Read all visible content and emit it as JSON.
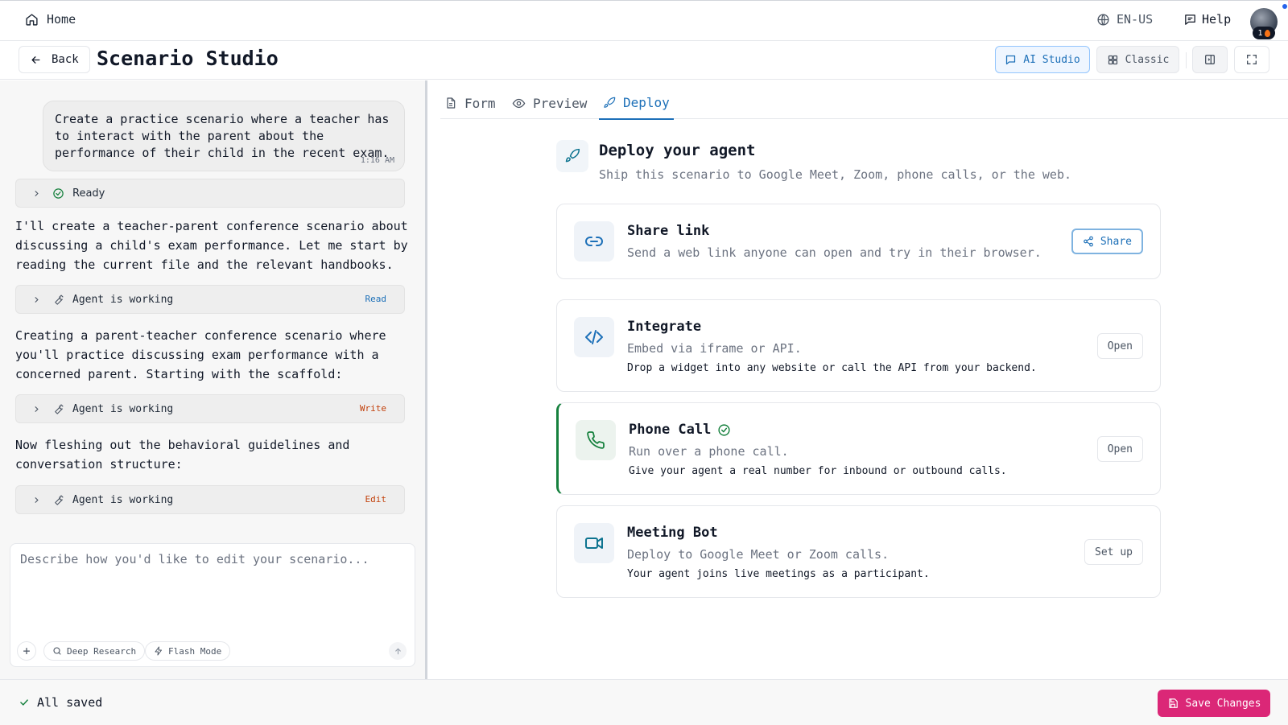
{
  "nav": {
    "home_label": "Home",
    "language": "EN-US",
    "help_label": "Help",
    "avatar_badge": "1"
  },
  "header": {
    "back_label": "Back",
    "title": "Scenario Studio",
    "mode_ai_label": "AI Studio",
    "mode_classic_label": "Classic"
  },
  "chat": {
    "user_message": "Create a practice scenario where a teacher has to interact with the parent about the performance of their child in the recent exam.",
    "user_time": "1:16 AM",
    "status_row": {
      "label": "Ready"
    },
    "messages": [
      "I'll create a teacher-parent conference scenario about discussing a child's exam performance. Let me start by reading the current file and the relevant handbooks.",
      "Creating a parent-teacher conference scenario where you'll practice discussing exam performance with a concerned parent. Starting with the scaffold:",
      "Now fleshing out the behavioral guidelines and conversation structure:"
    ],
    "tool_rows": [
      {
        "label": "Agent is working",
        "tag": "Read",
        "tag_color": "#1d70b8"
      },
      {
        "label": "Agent is working",
        "tag": "Write",
        "tag_color": "#c2410c"
      },
      {
        "label": "Agent is working",
        "tag": "Edit",
        "tag_color": "#c2410c"
      }
    ],
    "input_placeholder": "Describe how you'd like to edit your scenario...",
    "chips": [
      "Deep Research",
      "Flash Mode"
    ]
  },
  "tabs": [
    {
      "label": "Form",
      "icon": "file-text-icon"
    },
    {
      "label": "Preview",
      "icon": "eye-icon"
    },
    {
      "label": "Deploy",
      "icon": "rocket-icon",
      "active": true
    }
  ],
  "deploy": {
    "title": "Deploy your agent",
    "subtitle": "Ship this scenario to Google Meet, Zoom, phone calls, or the web.",
    "cards": [
      {
        "title": "Share link",
        "desc": "Send a web link anyone can open and try in their browser.",
        "detail": "",
        "button": "Share",
        "icon": "link-icon"
      },
      {
        "title": "Integrate",
        "desc": "Embed via iframe or API.",
        "detail": "Drop a widget into any website or call the API from your backend.",
        "button": "Open",
        "icon": "code-icon"
      },
      {
        "title": "Phone Call",
        "desc": "Run over a phone call.",
        "detail": "Give your agent a real number for inbound or outbound calls.",
        "button": "Open",
        "icon": "phone-icon",
        "selected": true
      },
      {
        "title": "Meeting Bot",
        "desc": "Deploy to Google Meet or Zoom calls.",
        "detail": "Your agent joins live meetings as a participant.",
        "button": "Set up",
        "icon": "video-icon"
      }
    ]
  },
  "footer": {
    "status": "All saved",
    "save_label": "Save Changes"
  },
  "colors": {
    "accent": "#1d70b8",
    "save_button": "#db2777",
    "success": "#15803d"
  }
}
